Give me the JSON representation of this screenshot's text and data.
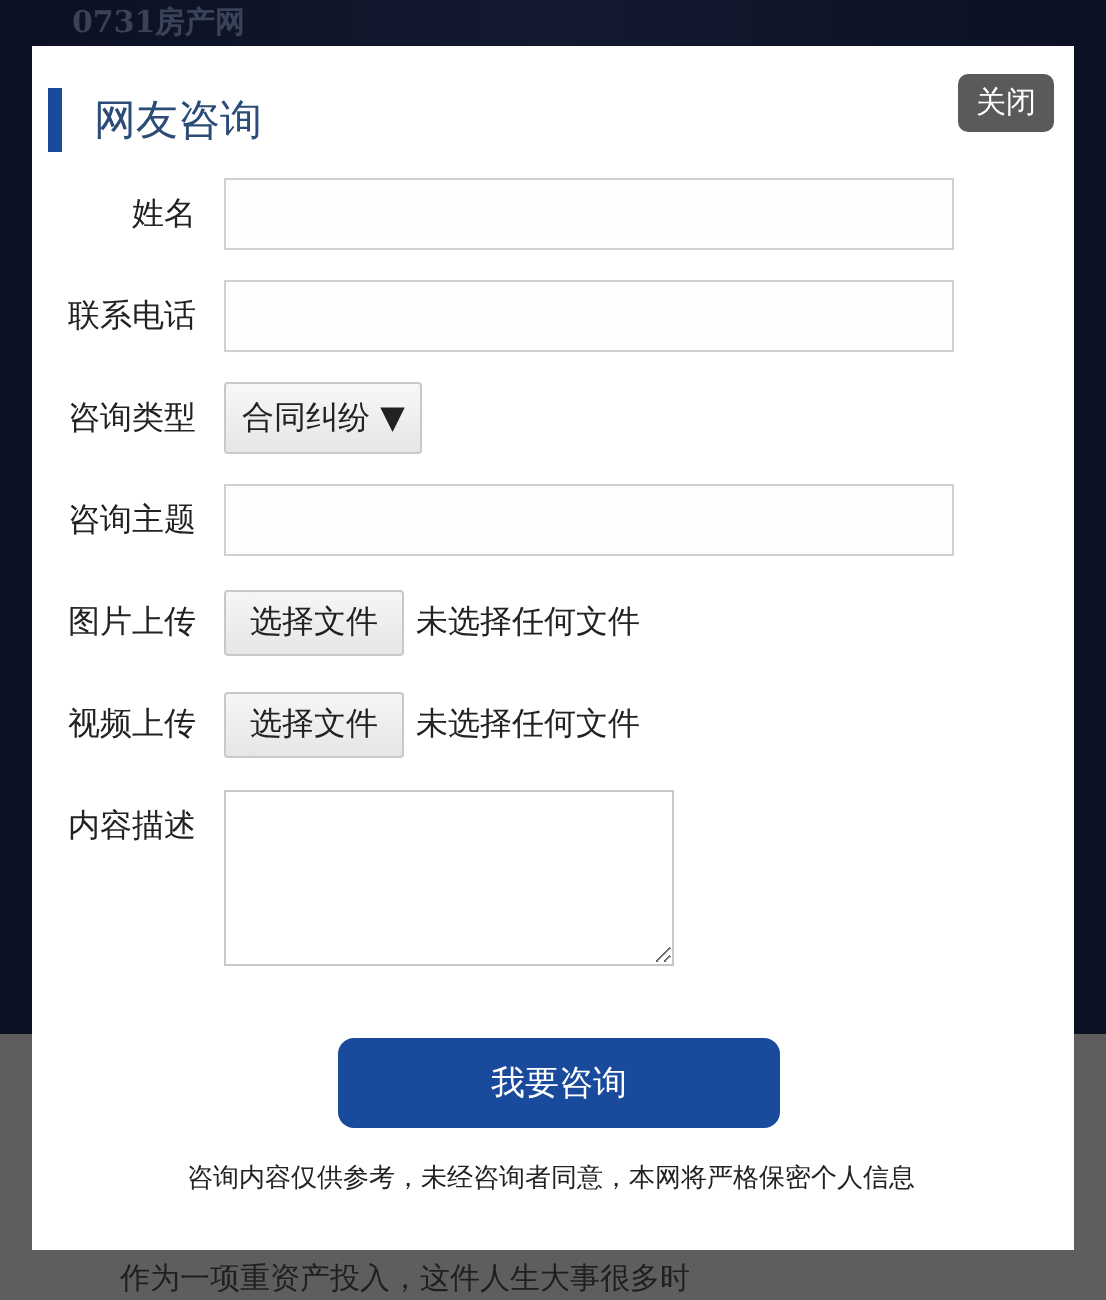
{
  "background": {
    "logo": "0731房产网",
    "article_text": "作为一项重资产投入，这件人生大事很多时"
  },
  "dialog": {
    "title": "网友咨询",
    "close_button": "关闭",
    "fields": [
      {
        "kind": "text",
        "label": "姓名"
      },
      {
        "kind": "text",
        "label": "联系电话"
      },
      {
        "kind": "select",
        "label": "咨询类型",
        "value": "合同纠纷",
        "arrow": "▼"
      },
      {
        "kind": "text",
        "label": "咨询主题"
      },
      {
        "kind": "file",
        "label": "图片上传",
        "button": "选择文件",
        "status": "未选择任何文件"
      },
      {
        "kind": "file",
        "label": "视频上传",
        "button": "选择文件",
        "status": "未选择任何文件"
      },
      {
        "kind": "textarea",
        "label": "内容描述"
      }
    ],
    "submit_button": "我要咨询",
    "notice": "咨询内容仅供参考，未经咨询者同意，本网将严格保密个人信息"
  }
}
